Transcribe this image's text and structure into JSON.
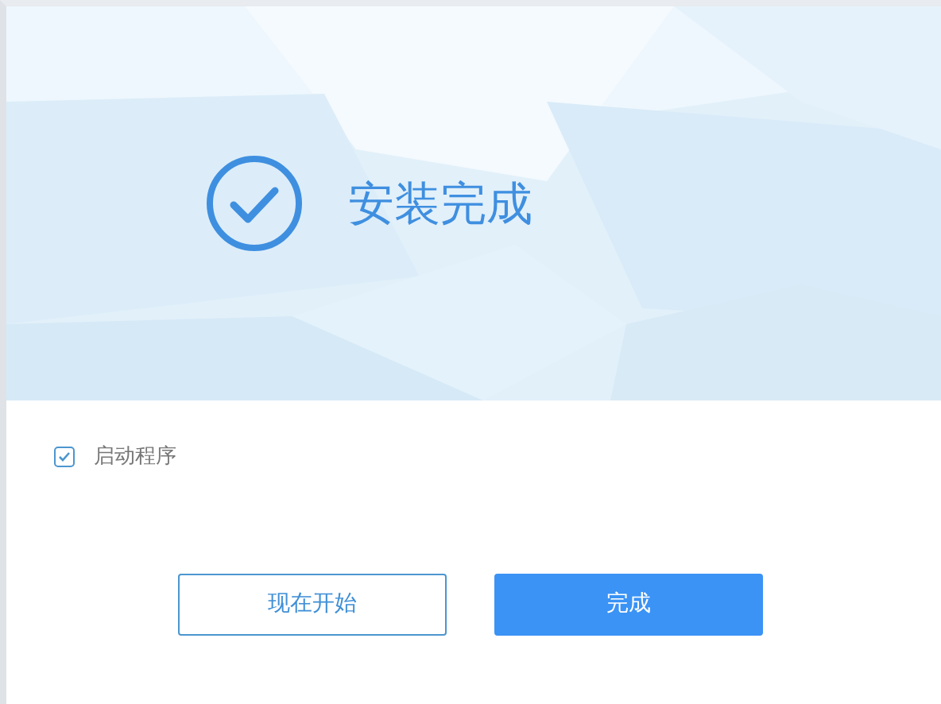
{
  "banner": {
    "title": "安装完成"
  },
  "options": [
    {
      "label": "启动程序",
      "checked": true
    }
  ],
  "buttons": [
    {
      "label": "现在开始",
      "kind": "outline"
    },
    {
      "label": "完成",
      "kind": "primary"
    }
  ]
}
